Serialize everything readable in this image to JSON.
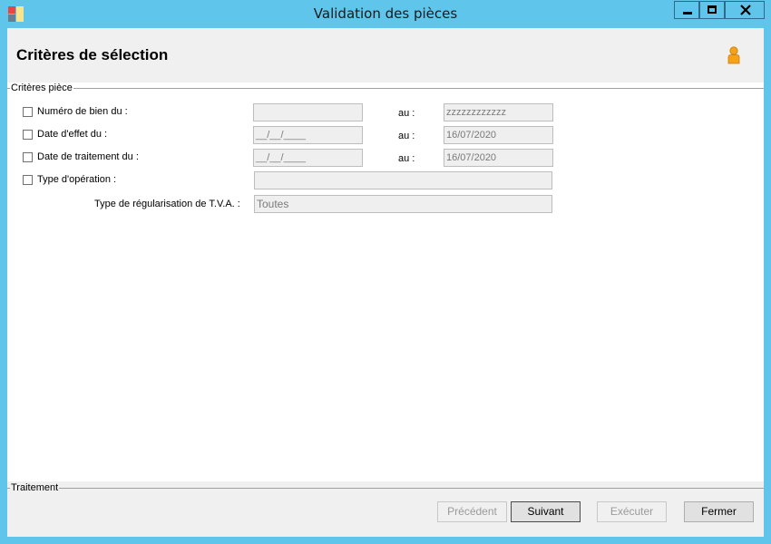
{
  "window": {
    "title": "Validation des pièces",
    "icons": {
      "app": "app-icon",
      "minimize": "minimize-icon",
      "maximize": "maximize-icon",
      "close": "close-icon"
    }
  },
  "header": {
    "title": "Critères de sélection",
    "user_icon": "user-icon"
  },
  "criteria": {
    "group_label": "Critères pièce",
    "to_label": "au :",
    "rows": [
      {
        "label": "Numéro de bien du :",
        "from_value": "",
        "to_value": "zzzzzzzzzzzz",
        "checked": false
      },
      {
        "label": "Date d'effet du :",
        "from_value": "__/__/____",
        "to_value": "16/07/2020",
        "checked": false
      },
      {
        "label": "Date de traitement du :",
        "from_value": "__/__/____",
        "to_value": "16/07/2020",
        "checked": false
      },
      {
        "label": "Type d'opération :",
        "value": "",
        "checked": false
      }
    ],
    "tva": {
      "label": "Type de régularisation de T.V.A. :",
      "value": "Toutes"
    }
  },
  "treatment": {
    "group_label": "Traitement",
    "buttons": {
      "previous": {
        "label": "Précédent",
        "enabled": false
      },
      "next": {
        "label": "Suivant",
        "enabled": true
      },
      "execute": {
        "label": "Exécuter",
        "enabled": false
      },
      "close": {
        "label": "Fermer",
        "enabled": true
      }
    }
  },
  "colors": {
    "title_bar": "#5fc5ea",
    "client_background": "#f0f0f0",
    "panel_background": "#ffffff",
    "disabled_text": "#9a9a9a"
  }
}
